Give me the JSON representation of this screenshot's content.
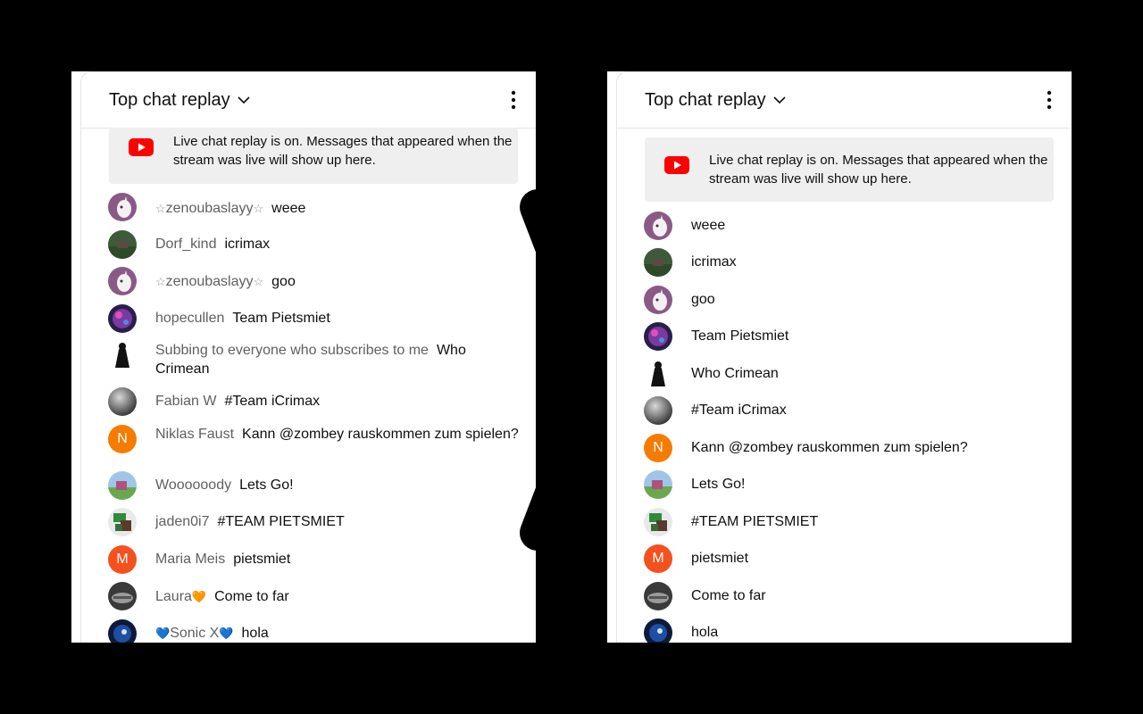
{
  "chat": {
    "title": "Top chat replay",
    "banner": "Live chat replay is on. Messages that appeared when the stream was live will show up here."
  },
  "colors": {
    "youtube_red": "#ff0000",
    "background": "#000000",
    "author_gray": "#606060",
    "banner_bg": "#efefef"
  },
  "icons": [
    "chevron-down-icon",
    "more-vert-icon",
    "youtube-logo-icon",
    "chevron-right-arrow-icon"
  ],
  "messages": [
    {
      "author": "zenoubaslayy",
      "author_decoration": "☆",
      "text": "weee",
      "avatar": "unicorn"
    },
    {
      "author": "Dorf_kind",
      "text": "icrimax",
      "avatar": "landscape"
    },
    {
      "author": "zenoubaslayy",
      "author_decoration": "☆",
      "text": "goo",
      "avatar": "unicorn"
    },
    {
      "author": "hopecullen",
      "text": "Team Pietsmiet",
      "avatar": "neon"
    },
    {
      "author": "Subbing to everyone who subscribes to me",
      "text": "Who Crimean",
      "avatar": "silhouette"
    },
    {
      "author": "Fabian W",
      "text": "#Team iCrimax",
      "avatar": "moon"
    },
    {
      "author": "Niklas Faust",
      "text": "Kann @zombey rauskommen zum spielen?",
      "avatar_letter": "N",
      "avatar": "letter"
    },
    {
      "author": "Woooooody",
      "text": "Lets Go!",
      "avatar": "field"
    },
    {
      "author": "jaden0i7",
      "text": "#TEAM PIETSMIET",
      "avatar": "character"
    },
    {
      "author": "Maria Meis",
      "text": "pietsmiet",
      "avatar_letter": "M",
      "avatar": "letter"
    },
    {
      "author": "Laura",
      "author_decoration": "🧡",
      "text": "Come to far",
      "avatar": "car"
    },
    {
      "author": "Sonic X",
      "author_decoration": "💙",
      "text": "hola",
      "avatar": "sonic"
    }
  ]
}
